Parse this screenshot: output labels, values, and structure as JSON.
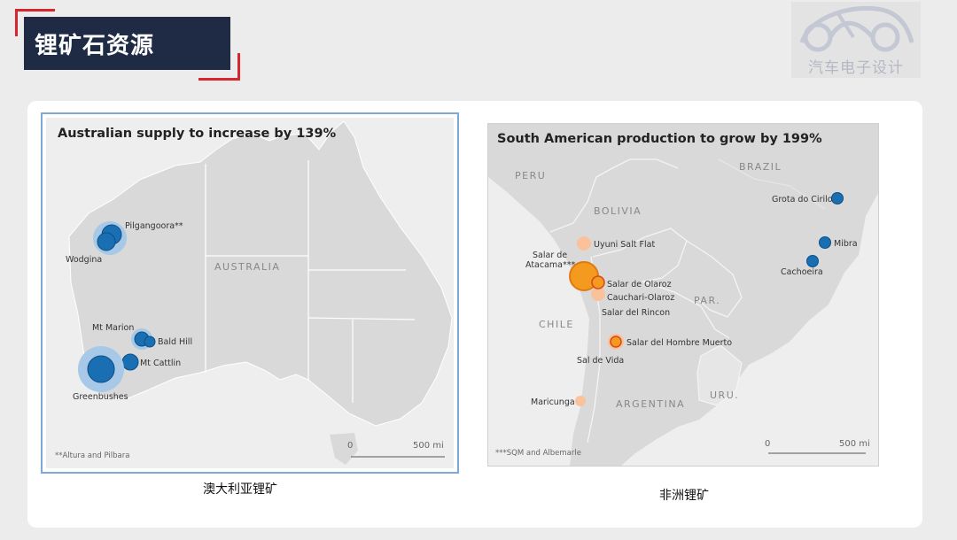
{
  "header": {
    "title": "锂矿石资源"
  },
  "logo": {
    "text": "汽车电子设计"
  },
  "australia_map": {
    "title": "Australian supply to increase by 139%",
    "region_label": "AUSTRALIA",
    "sites": [
      "Pilgangoora**",
      "Wodgina",
      "Mt Marion",
      "Bald Hill",
      "Mt Cattlin",
      "Greenbushes"
    ],
    "footnote": "**Altura and Pilbara",
    "scale_start": "0",
    "scale_end": "500 mi",
    "caption": "澳大利亚锂矿"
  },
  "south_america_map": {
    "title": "South American production to grow by 199%",
    "countries": [
      "PERU",
      "BRAZIL",
      "BOLIVIA",
      "CHILE",
      "PAR.",
      "ARGENTINA",
      "URU."
    ],
    "sites": [
      "Uyuni Salt Flat",
      "Salar de",
      "Atacama***",
      "Salar de Olaroz",
      "Cauchari-Olaroz",
      "Salar del Rincon",
      "Salar del Hombre Muerto",
      "Sal de Vida",
      "Maricunga",
      "Grota do Cirilo",
      "Mibra",
      "Cachoeira"
    ],
    "footnote": "***SQM and Albemarle",
    "scale_start": "0",
    "scale_end": "500 mi",
    "caption": "非洲锂矿"
  },
  "colors": {
    "title_bg": "#1f2a44",
    "accent_red": "#d8262e",
    "site_blue": "#1a6fb3",
    "site_halo_blue": "#a7c8e6",
    "site_orange": "#f39a1f",
    "site_light_orange": "#f9c29b",
    "land": "#dadada",
    "sea": "#eeeeee"
  }
}
